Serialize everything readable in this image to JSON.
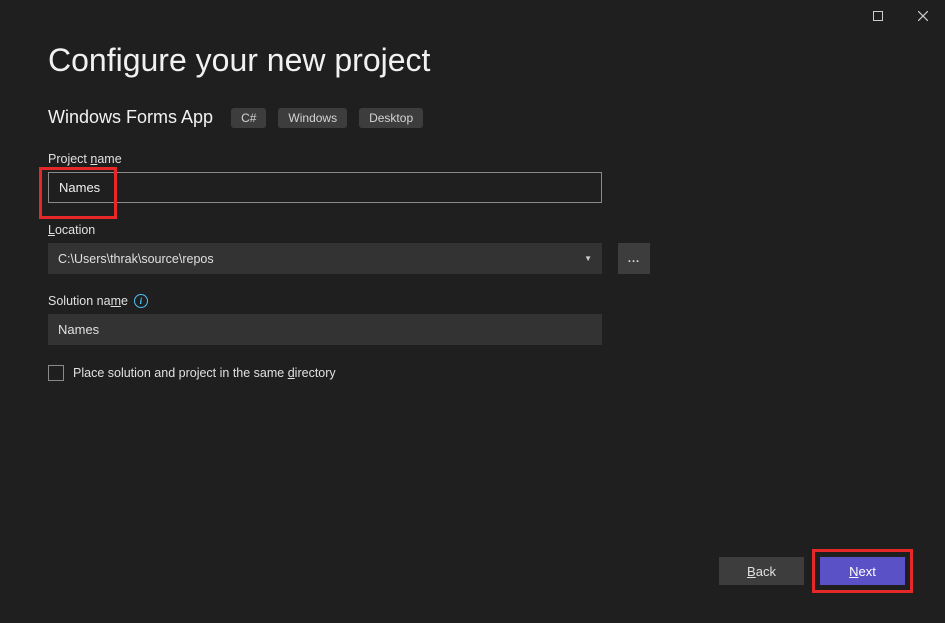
{
  "titlebar": {
    "maximize_tooltip": "Maximize",
    "close_tooltip": "Close"
  },
  "page": {
    "title": "Configure your new project"
  },
  "template": {
    "name": "Windows Forms App",
    "tags": [
      "C#",
      "Windows",
      "Desktop"
    ]
  },
  "fields": {
    "project_name": {
      "label_pre": "Project ",
      "label_u": "n",
      "label_post": "ame",
      "value": "Names"
    },
    "location": {
      "label_u": "L",
      "label_post": "ocation",
      "value": "C:\\Users\\thrak\\source\\repos",
      "browse": "..."
    },
    "solution_name": {
      "label_pre": "Solution na",
      "label_u": "m",
      "label_post": "e",
      "value": "Names"
    },
    "same_dir": {
      "label_pre": "Place solution and project in the same ",
      "label_u": "d",
      "label_post": "irectory"
    }
  },
  "footer": {
    "back_u": "B",
    "back_post": "ack",
    "next_u": "N",
    "next_post": "ext"
  }
}
